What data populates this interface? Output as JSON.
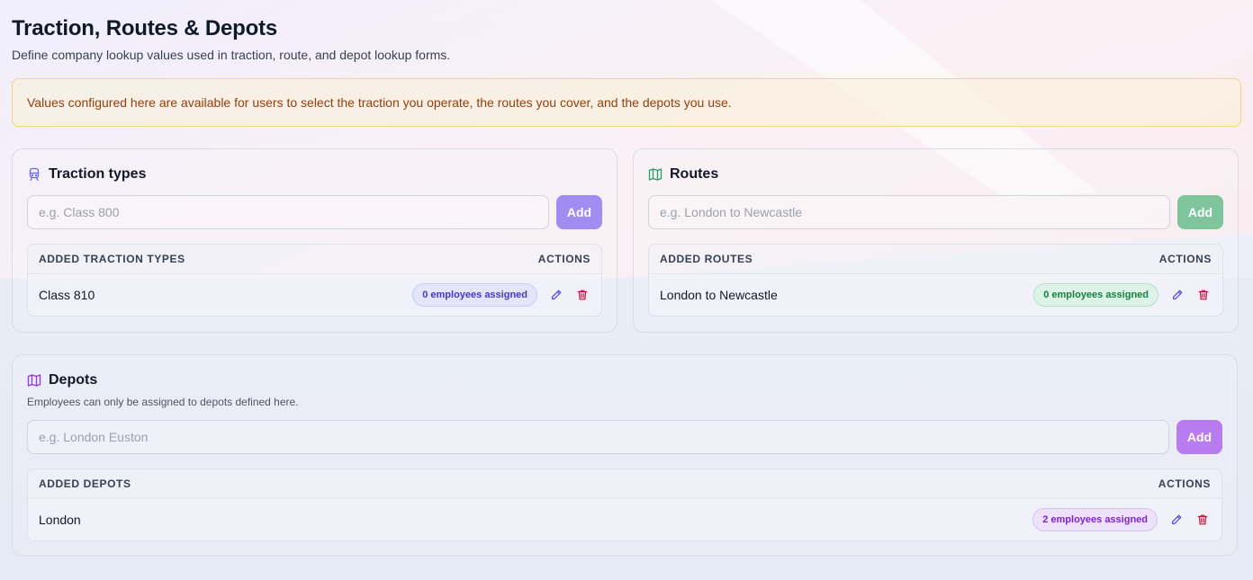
{
  "page": {
    "title": "Traction, Routes & Depots",
    "subtitle": "Define company lookup values used in traction, route, and depot lookup forms."
  },
  "notice": {
    "text": "Values configured here are available for users to select the traction you operate, the routes you cover, and the depots you use."
  },
  "traction": {
    "title": "Traction types",
    "icon": "train-icon",
    "placeholder": "e.g. Class 800",
    "add_label": "Add",
    "list_header": "ADDED TRACTION TYPES",
    "actions_header": "ACTIONS",
    "items": [
      {
        "name": "Class 810",
        "badge": "0 employees assigned"
      }
    ]
  },
  "routes": {
    "title": "Routes",
    "icon": "map-icon",
    "placeholder": "e.g. London to Newcastle",
    "add_label": "Add",
    "list_header": "ADDED ROUTES",
    "actions_header": "ACTIONS",
    "items": [
      {
        "name": "London to Newcastle",
        "badge": "0 employees assigned"
      }
    ]
  },
  "depots": {
    "title": "Depots",
    "icon": "map-icon",
    "description": "Employees can only be assigned to depots defined here.",
    "placeholder": "e.g. London Euston",
    "add_label": "Add",
    "list_header": "ADDED DEPOTS",
    "actions_header": "ACTIONS",
    "items": [
      {
        "name": "London",
        "badge": "2 employees assigned"
      }
    ]
  },
  "colors": {
    "traction_accent": "#a18cf2",
    "routes_accent": "#7ec59c",
    "depots_accent": "#b87cf0",
    "delete": "#be123c",
    "notice_text": "#92400e"
  }
}
